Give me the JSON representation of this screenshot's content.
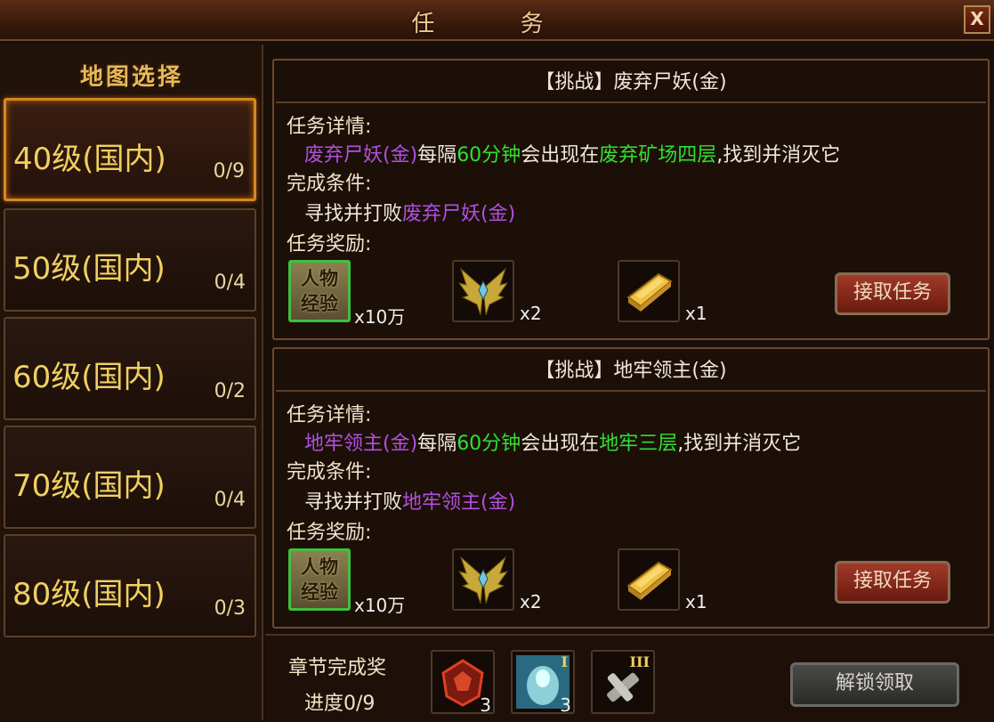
{
  "window": {
    "title": "任 务",
    "close_label": "X"
  },
  "sidebar": {
    "header": "地图选择",
    "items": [
      {
        "label": "40级(国内)",
        "count": "0/9",
        "selected": true
      },
      {
        "label": "50级(国内)",
        "count": "0/4"
      },
      {
        "label": "60级(国内)",
        "count": "0/2"
      },
      {
        "label": "70级(国内)",
        "count": "0/4"
      },
      {
        "label": "80级(国内)",
        "count": "0/3"
      }
    ]
  },
  "quests": [
    {
      "title": "【挑战】废弃尸妖(金)",
      "detail_label": "任务详情:",
      "detail": {
        "monster": "废弃尸妖(金)",
        "t1": "每隔",
        "interval": "60分钟",
        "t2": "会出现在",
        "location": "废弃矿场四层",
        "t3": ",找到并消灭它"
      },
      "condition_label": "完成条件:",
      "condition": {
        "prefix": "寻找并打败",
        "monster": "废弃尸妖(金)"
      },
      "reward_label": "任务奖励:",
      "rewards": [
        {
          "icon": "exp-icon",
          "icon_text_1": "人物",
          "icon_text_2": "经验",
          "qty": "x10万"
        },
        {
          "icon": "wings-icon",
          "qty": "x2"
        },
        {
          "icon": "gold-bar-icon",
          "qty": "x1"
        }
      ],
      "accept_label": "接取任务"
    },
    {
      "title": "【挑战】地牢领主(金)",
      "detail_label": "任务详情:",
      "detail": {
        "monster": "地牢领主(金)",
        "t1": "每隔",
        "interval": "60分钟",
        "t2": "会出现在",
        "location": "地牢三层",
        "t3": ",找到并消灭它"
      },
      "condition_label": "完成条件:",
      "condition": {
        "prefix": "寻找并打败",
        "monster": "地牢领主(金)"
      },
      "reward_label": "任务奖励:",
      "rewards": [
        {
          "icon": "exp-icon",
          "icon_text_1": "人物",
          "icon_text_2": "经验",
          "qty": "x10万"
        },
        {
          "icon": "wings-icon",
          "qty": "x2"
        },
        {
          "icon": "gold-bar-icon",
          "qty": "x1"
        }
      ],
      "accept_label": "接取任务"
    }
  ],
  "chapter": {
    "label": "章节完成奖",
    "progress": "进度0/9",
    "items": [
      {
        "icon": "red-gem-icon",
        "qty": "3"
      },
      {
        "icon": "spirit-crystal-icon",
        "tier": "I",
        "qty": "3"
      },
      {
        "icon": "hammer-scroll-icon",
        "tier": "III"
      }
    ],
    "unlock_label": "解锁领取"
  }
}
